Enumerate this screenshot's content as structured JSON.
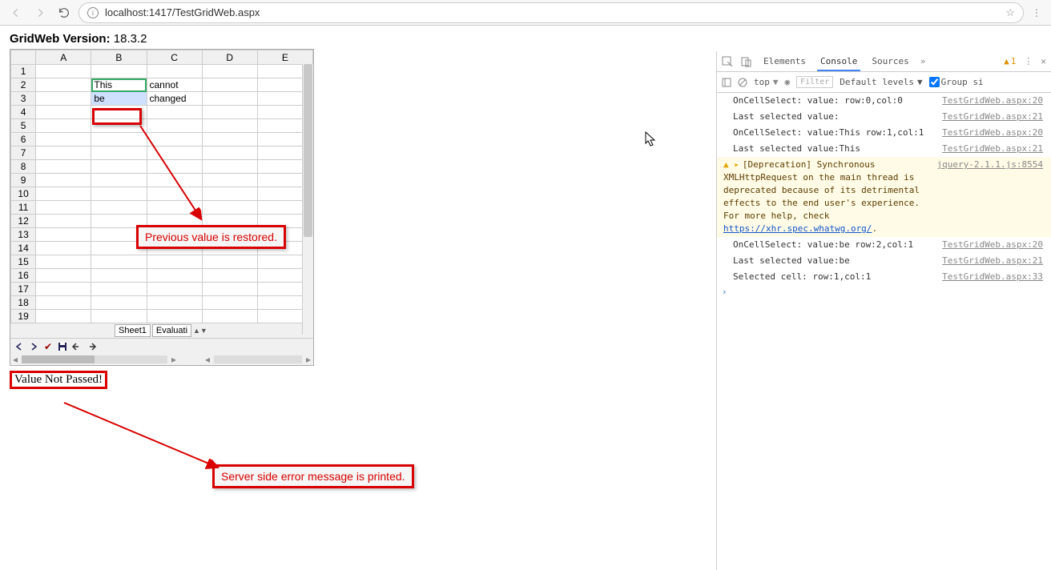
{
  "browser": {
    "url": "localhost:1417/TestGridWeb.aspx"
  },
  "page": {
    "version_label": "GridWeb Version:",
    "version_value": "18.3.2",
    "status_message": "Value Not Passed!"
  },
  "grid": {
    "columns": [
      "A",
      "B",
      "C",
      "D",
      "E"
    ],
    "row_count": 19,
    "cells": {
      "B2": "This",
      "C2": "cannot",
      "B3": "be",
      "C3": "changed"
    },
    "sheet_tabs": [
      "Sheet1",
      "Evaluati"
    ]
  },
  "annotations": {
    "restored": "Previous value is restored.",
    "server_msg": "Server side error message is printed."
  },
  "devtools": {
    "tabs": [
      "Elements",
      "Console",
      "Sources"
    ],
    "active_tab": "Console",
    "warn_count": "1",
    "context": "top",
    "filter_placeholder": "Filter",
    "levels_label": "Default levels",
    "group_label": "Group si",
    "logs": [
      {
        "msg": "OnCellSelect: value: row:0,col:0",
        "src": "TestGridWeb.aspx:20"
      },
      {
        "msg": "Last selected value:",
        "src": "TestGridWeb.aspx:21"
      },
      {
        "msg": "OnCellSelect: value:This row:1,col:1",
        "src": "TestGridWeb.aspx:20"
      },
      {
        "msg": "Last selected value:This",
        "src": "TestGridWeb.aspx:21"
      },
      {
        "type": "warn",
        "msg_pre": "[Deprecation] Synchronous XMLHttpRequest on the main thread is deprecated because of its detrimental effects to the end user's experience. For more help, check ",
        "link": "https://xhr.spec.whatwg.org/",
        "msg_post": ".",
        "src": "jquery-2.1.1.js:8554"
      },
      {
        "msg": "OnCellSelect: value:be row:2,col:1",
        "src": "TestGridWeb.aspx:20"
      },
      {
        "msg": "Last selected value:be",
        "src": "TestGridWeb.aspx:21"
      },
      {
        "msg": "Selected cell: row:1,col:1",
        "src": "TestGridWeb.aspx:33"
      }
    ]
  }
}
